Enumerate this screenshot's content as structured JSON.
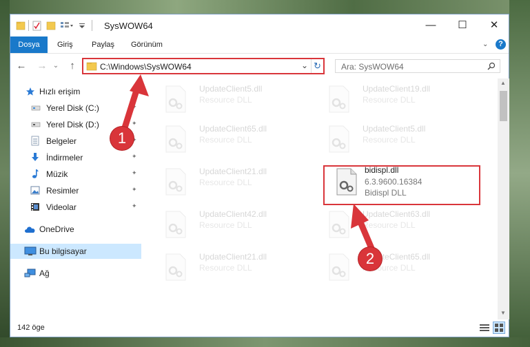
{
  "window": {
    "title": "SysWOW64",
    "controls": {
      "minimize": "—",
      "maximize": "☐",
      "close": "✕"
    }
  },
  "ribbon": {
    "tabs": [
      {
        "label": "Dosya",
        "active": true
      },
      {
        "label": "Giriş"
      },
      {
        "label": "Paylaş"
      },
      {
        "label": "Görünüm"
      }
    ],
    "help_icon": "?"
  },
  "nav": {
    "back": "←",
    "forward": "→",
    "recent": "⌄",
    "up": "↑",
    "address": "C:\\Windows\\SysWOW64",
    "dropdown": "⌄",
    "refresh": "↻",
    "search_placeholder": "Ara: SysWOW64"
  },
  "sidebar": {
    "items": [
      {
        "label": "Hızlı erişim",
        "icon": "star-icon"
      },
      {
        "label": "Yerel Disk (C:)",
        "icon": "drive-icon",
        "pinned": true
      },
      {
        "label": "Yerel Disk (D:)",
        "icon": "drive-icon",
        "pinned": true
      },
      {
        "label": "Belgeler",
        "icon": "document-icon",
        "pinned": true
      },
      {
        "label": "İndirmeler",
        "icon": "download-icon",
        "pinned": true
      },
      {
        "label": "Müzik",
        "icon": "music-icon",
        "pinned": true
      },
      {
        "label": "Resimler",
        "icon": "pictures-icon",
        "pinned": true
      },
      {
        "label": "Videolar",
        "icon": "video-icon",
        "pinned": true
      },
      {
        "label": "OneDrive",
        "icon": "cloud-icon"
      },
      {
        "label": "Bu bilgisayar",
        "icon": "computer-icon",
        "selected": true
      },
      {
        "label": "Ağ",
        "icon": "network-icon"
      }
    ],
    "pin_icon": "📌"
  },
  "files": [
    {
      "name": "UpdateClient5.dll",
      "type": "Resource DLL",
      "faded": true
    },
    {
      "name": "UpdateClient19.dll",
      "type": "Resource DLL",
      "faded": true
    },
    {
      "name": "UpdateClient65.dll",
      "type": "Resource DLL",
      "faded": true
    },
    {
      "name": "UpdateClient5.dll",
      "type": "Resource DLL",
      "faded": true
    },
    {
      "name": "UpdateClient21.dll",
      "type": "Resource DLL",
      "faded": true
    },
    {
      "name": "bidispl.dll",
      "version": "6.3.9600.16384",
      "type": "Bidispl DLL",
      "faded": false
    },
    {
      "name": "UpdateClient42.dll",
      "type": "Resource DLL",
      "faded": true
    },
    {
      "name": "UpdateClient63.dll",
      "type": "Resource DLL",
      "faded": true
    },
    {
      "name": "UpdateClient21.dll",
      "type": "Resource DLL",
      "faded": true
    },
    {
      "name": "UpdateClient65.dll",
      "type": "Resource DLL",
      "faded": true
    }
  ],
  "status": {
    "item_count": "142 öge"
  },
  "annotations": {
    "step1": "1",
    "step2": "2"
  },
  "colors": {
    "accent": "#1979ca",
    "highlight_red": "#d9353a",
    "selected_bg": "#cce8ff"
  }
}
